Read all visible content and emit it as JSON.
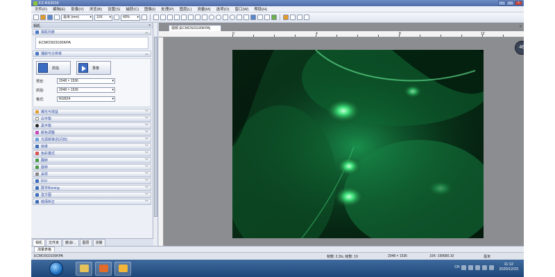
{
  "window": {
    "title": "FZ-RS2018"
  },
  "menu": [
    "文件(F)",
    "编辑(E)",
    "影像(V)",
    "浏览(B)",
    "设置(S)",
    "捕获(C)",
    "图像(I)",
    "处理(P)",
    "图层(L)",
    "测量(M)",
    "选项(O)",
    "窗口(W)",
    "帮助(H)"
  ],
  "toolbar": {
    "unit": "毫米 (mm)",
    "magnification": "10X",
    "zoom": "40%"
  },
  "left_panel": {
    "header": "相机",
    "camera_list_title": "相机列表",
    "camera_name": "ECMOS03100KPA",
    "capture_title": "捕获与分辨率",
    "snap_label": "抓拍",
    "record_label": "录像",
    "preview_label": "预览:",
    "preview_value": "2048 × 1536",
    "snap_res_label": "抓拍:",
    "snap_res_value": "2048 × 1536",
    "format_label": "格式:",
    "format_value": "RGB24",
    "sections": [
      "曝光与增益",
      "白平衡",
      "黑平衡",
      "颜色调整",
      "光源频率(抗闪烁)",
      "帧率",
      "色彩模式",
      "翻转",
      "旋转",
      "采样",
      "ROI",
      "数字Binning",
      "直方图",
      "暗场矫正"
    ],
    "bottom_tabs": [
      "相机",
      "文件夹",
      "撤消/...",
      "图层",
      "测量"
    ]
  },
  "document": {
    "tab_label": "视频 [ECMOS03100KPA]",
    "ruler_top_labels": [
      "0",
      "4",
      "8",
      "12"
    ]
  },
  "perf_widget": {
    "percent": "46",
    "percent_unit": "%"
  },
  "measure_tab": "测量表格",
  "status": {
    "camera": "ECMOS03100KPA",
    "frames": "帧数: 2.3/s, 帧数: 19",
    "resolution": "2048 × 1536",
    "scale": "10X: 199680.10",
    "unit": "毫米"
  },
  "taskbar": {
    "lang": "CH",
    "time": "11:12",
    "date": "2020/12/23"
  },
  "colors": {
    "titlebar": "#5a78b4",
    "taskbar": "#2a5586",
    "accent_blue": "#2a48a0"
  }
}
